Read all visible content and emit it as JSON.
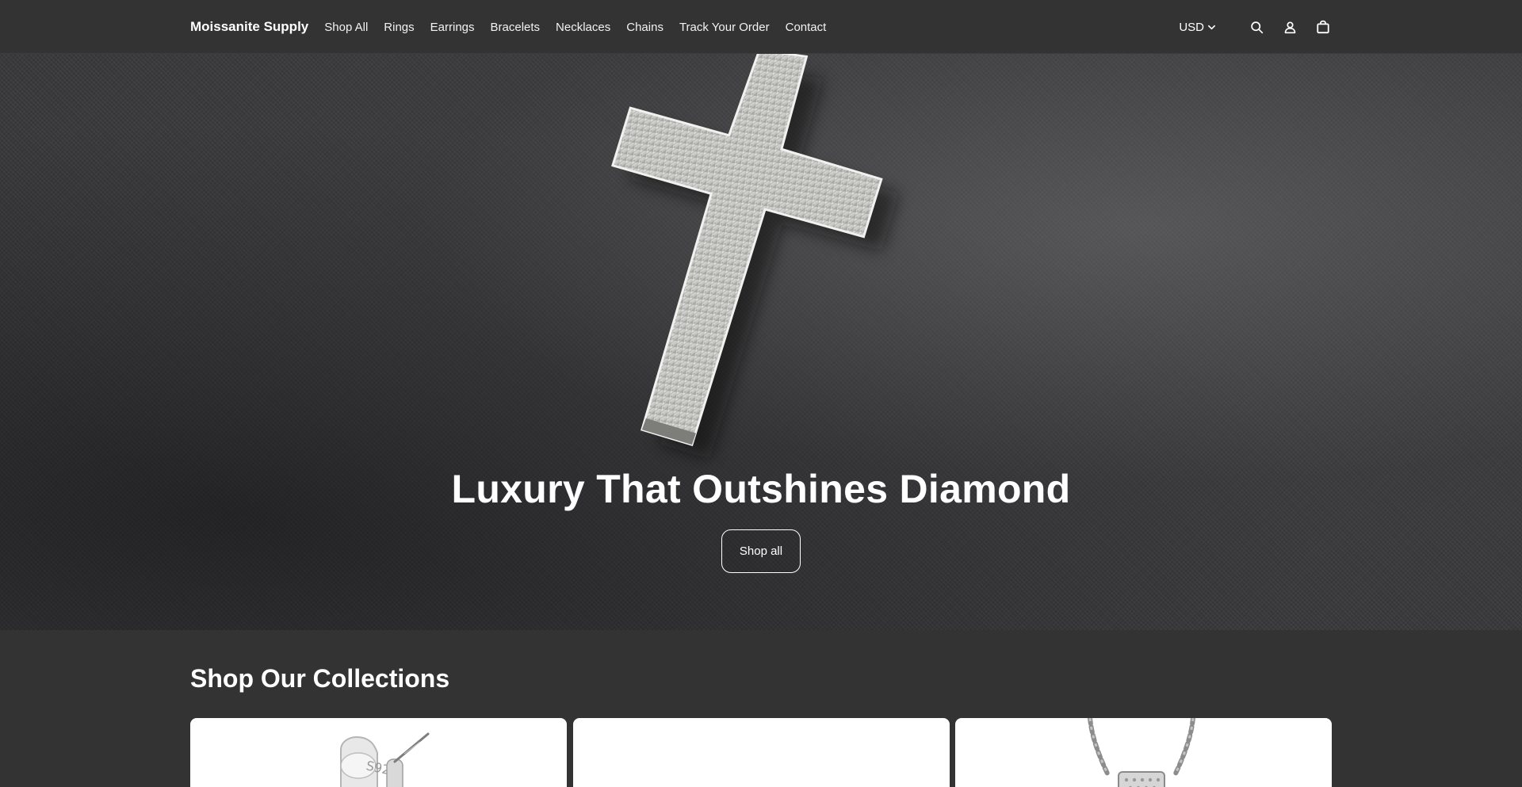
{
  "header": {
    "logo": "Moissanite Supply",
    "nav": [
      {
        "label": "Shop All"
      },
      {
        "label": "Rings"
      },
      {
        "label": "Earrings"
      },
      {
        "label": "Bracelets"
      },
      {
        "label": "Necklaces"
      },
      {
        "label": "Chains"
      },
      {
        "label": "Track Your Order"
      },
      {
        "label": "Contact"
      }
    ],
    "currency": "USD",
    "icons": [
      "chevron-down-icon",
      "search-icon",
      "account-icon",
      "cart-icon"
    ]
  },
  "hero": {
    "title": "Luxury That Outshines Diamond",
    "button_label": "Shop all"
  },
  "collections": {
    "title": "Shop Our Collections",
    "cards": [
      {
        "image": "silver-earring-image",
        "stamp": "S925"
      },
      {
        "image": "blank-image"
      },
      {
        "image": "rope-chain-image"
      }
    ]
  },
  "colors": {
    "background": "#333333",
    "text": "#ffffff",
    "card": "#ffffff"
  }
}
